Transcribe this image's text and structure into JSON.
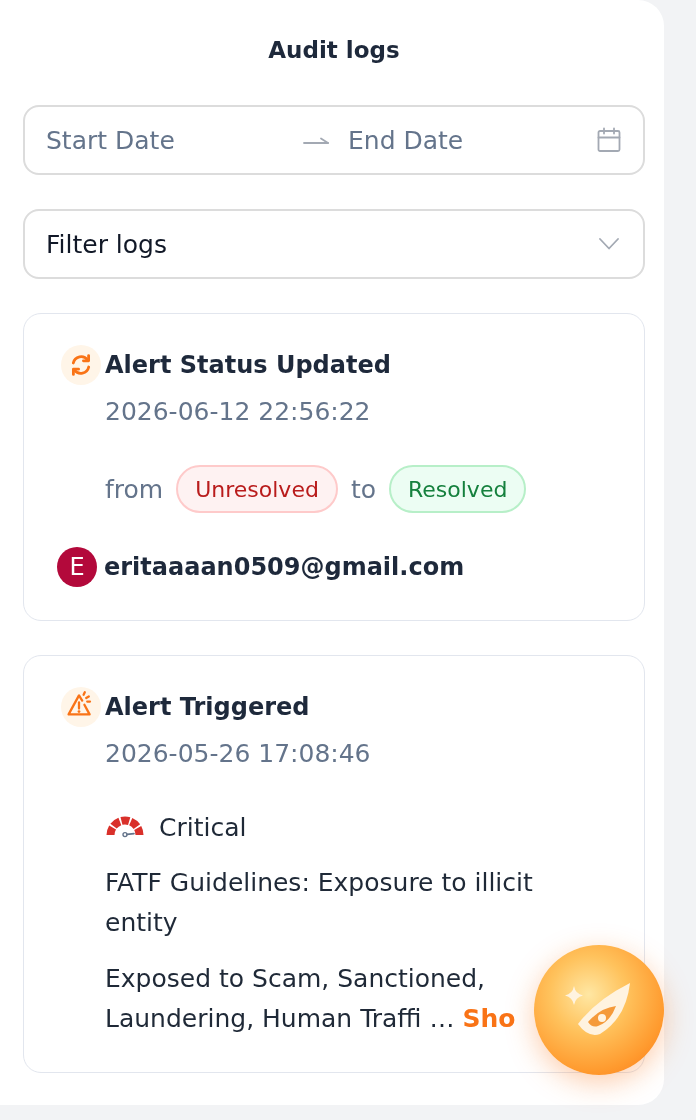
{
  "panel": {
    "title": "Audit logs"
  },
  "date_range": {
    "start_placeholder": "Start Date",
    "end_placeholder": "End Date"
  },
  "filter": {
    "label": "Filter logs"
  },
  "logs": [
    {
      "kind": "status_change",
      "title": "Alert Status Updated",
      "timestamp": "2026-06-12 22:56:22",
      "from_label": "from",
      "from_status": {
        "label": "Unresolved",
        "kind": "unresolved"
      },
      "to_label": "to",
      "to_status": {
        "label": "Resolved",
        "kind": "resolved"
      },
      "user": {
        "initial": "E",
        "email": "eritaaaan0509@gmail.com"
      }
    },
    {
      "kind": "alert",
      "title": "Alert Triggered",
      "timestamp": "2026-05-26 17:08:46",
      "severity": {
        "label": "Critical",
        "kind": "critical"
      },
      "rule": "FATF Guidelines: Exposure to illicit entity",
      "description": "Exposed to Scam, Sanctioned, Laundering, Human Traffi …",
      "more_link": "Sho"
    }
  ]
}
